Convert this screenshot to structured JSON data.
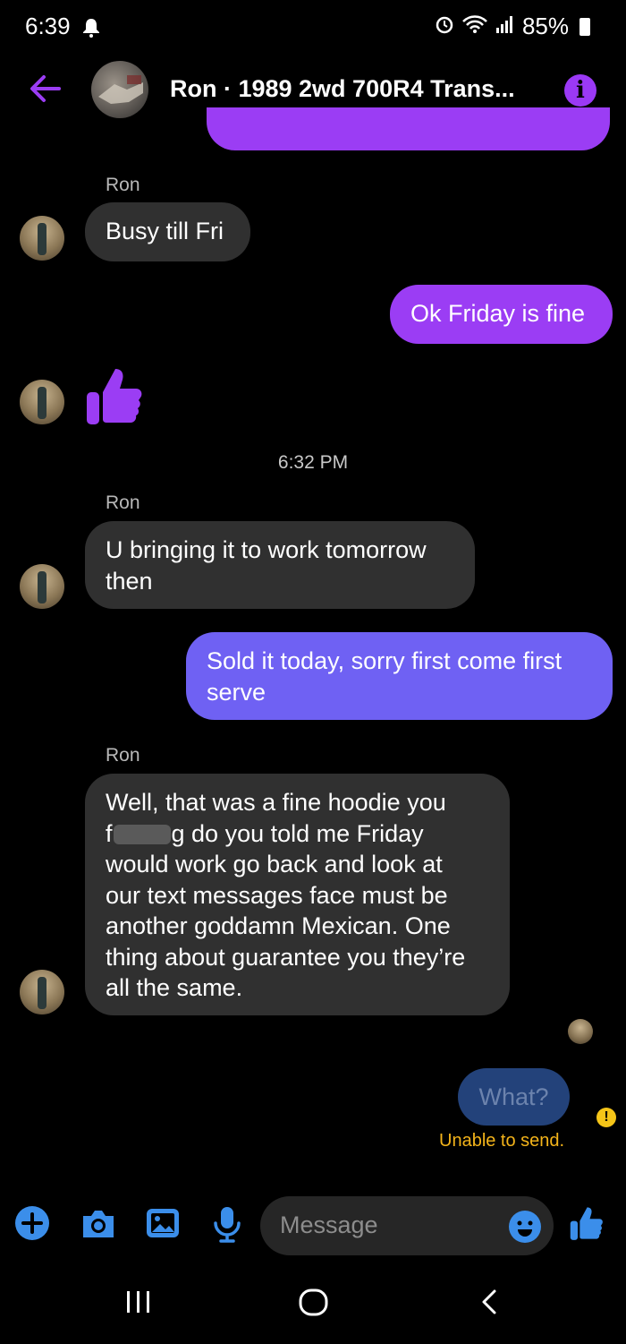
{
  "status_bar": {
    "time": "6:39",
    "battery": "85%"
  },
  "header": {
    "title": "Ron · 1989 2wd 700R4 Trans..."
  },
  "messages": {
    "m1_sender": "Ron",
    "m1_text": "Busy till Fri",
    "m2_text": "Ok Friday is fine",
    "timestamp": "6:32 PM",
    "m4_sender": "Ron",
    "m4_line1": "U bringing it to work tomorrow",
    "m4_line2": "then",
    "m5_line1": "Sold it today, sorry first come first",
    "m5_line2": "serve",
    "m6_sender": "Ron",
    "m6_line1": "Well, that was a fine hoodie you",
    "m6_line2a": "f",
    "m6_line2b": "g do you told me Friday",
    "m6_line3": "would work go back and look at",
    "m6_line4": "our text messages face must be",
    "m6_line5": "another goddamn Mexican. One",
    "m6_line6": "thing about guarantee you they’re",
    "m6_line7": "all the same.",
    "failed_text": "What?",
    "failed_status": "Unable to send."
  },
  "composer": {
    "placeholder": "Message"
  },
  "colors": {
    "accent_purple": "#9b3df4",
    "accent_blue": "#3b8eea",
    "incoming_bubble": "#303030",
    "warning": "#f4b41a"
  },
  "icons": [
    "bell-icon",
    "alarm-icon",
    "wifi-icon",
    "signal-icon",
    "battery-icon",
    "back-arrow-icon",
    "info-icon",
    "thumbs-up-icon",
    "plus-icon",
    "camera-icon",
    "image-icon",
    "mic-icon",
    "emoji-icon",
    "recent-apps-icon",
    "home-icon",
    "nav-back-icon"
  ]
}
